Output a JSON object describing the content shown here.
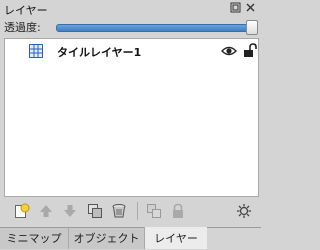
{
  "panel": {
    "title": "レイヤー",
    "restore_icon": "restore-icon",
    "close_icon": "close-icon"
  },
  "opacity": {
    "label": "透過度:",
    "level_percent": 100,
    "accent_color": "#4a8ad2"
  },
  "layers": [
    {
      "name": "タイルレイヤー1",
      "type_icon": "tile-layer-grid-icon",
      "visible": true,
      "locked": false
    }
  ],
  "toolbar": {
    "icons": [
      "new-layer-icon",
      "move-up-icon",
      "move-down-icon",
      "duplicate-icon",
      "delete-icon",
      "merge-icon",
      "lock-icon",
      "settings-icon"
    ]
  },
  "tabs": [
    {
      "label": "ミニマップ",
      "active": false
    },
    {
      "label": "オブジェクト",
      "active": false
    },
    {
      "label": "レイヤー",
      "active": true
    }
  ]
}
